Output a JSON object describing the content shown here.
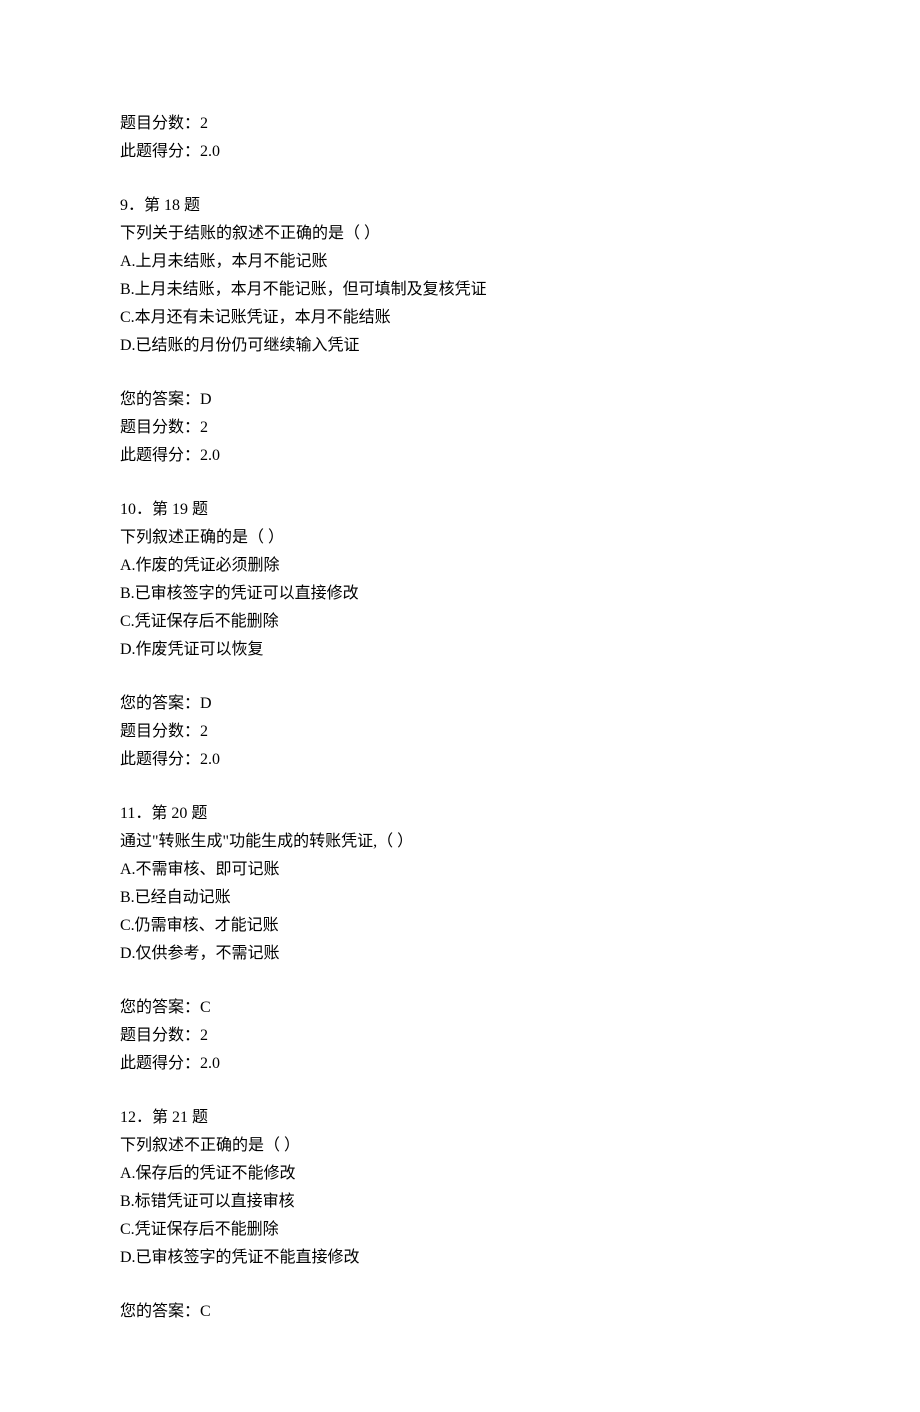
{
  "prelude": {
    "score_label": "题目分数：",
    "score_value": "2",
    "earned_label": "此题得分：",
    "earned_value": "2.0"
  },
  "questions": [
    {
      "header": "9．第 18 题",
      "stem": "下列关于结账的叙述不正确的是（ ）",
      "options": [
        "A.上月未结账，本月不能记账",
        "B.上月未结账，本月不能记账，但可填制及复核凭证",
        "C.本月还有未记账凭证，本月不能结账",
        "D.已结账的月份仍可继续输入凭证"
      ],
      "answer_label": "您的答案：",
      "answer_value": "D",
      "score_label": "题目分数：",
      "score_value": "2",
      "earned_label": "此题得分：",
      "earned_value": "2.0"
    },
    {
      "header": "10．第 19 题",
      "stem": "下列叙述正确的是（ ）",
      "options": [
        "A.作废的凭证必须删除",
        "B.已审核签字的凭证可以直接修改",
        "C.凭证保存后不能删除",
        "D.作废凭证可以恢复"
      ],
      "answer_label": "您的答案：",
      "answer_value": "D",
      "score_label": "题目分数：",
      "score_value": "2",
      "earned_label": "此题得分：",
      "earned_value": "2.0"
    },
    {
      "header": "11．第 20 题",
      "stem": "通过\"转账生成\"功能生成的转账凭证,（ ）",
      "options": [
        "A.不需审核、即可记账",
        "B.已经自动记账",
        "C.仍需审核、才能记账",
        "D.仅供参考，不需记账"
      ],
      "answer_label": "您的答案：",
      "answer_value": "C",
      "score_label": "题目分数：",
      "score_value": "2",
      "earned_label": "此题得分：",
      "earned_value": "2.0"
    },
    {
      "header": "12．第 21 题",
      "stem": "下列叙述不正确的是（ ）",
      "options": [
        "A.保存后的凭证不能修改",
        "B.标错凭证可以直接审核",
        "C.凭证保存后不能删除",
        "D.已审核签字的凭证不能直接修改"
      ],
      "answer_label": "您的答案：",
      "answer_value": "C",
      "score_label": "",
      "score_value": "",
      "earned_label": "",
      "earned_value": ""
    }
  ]
}
